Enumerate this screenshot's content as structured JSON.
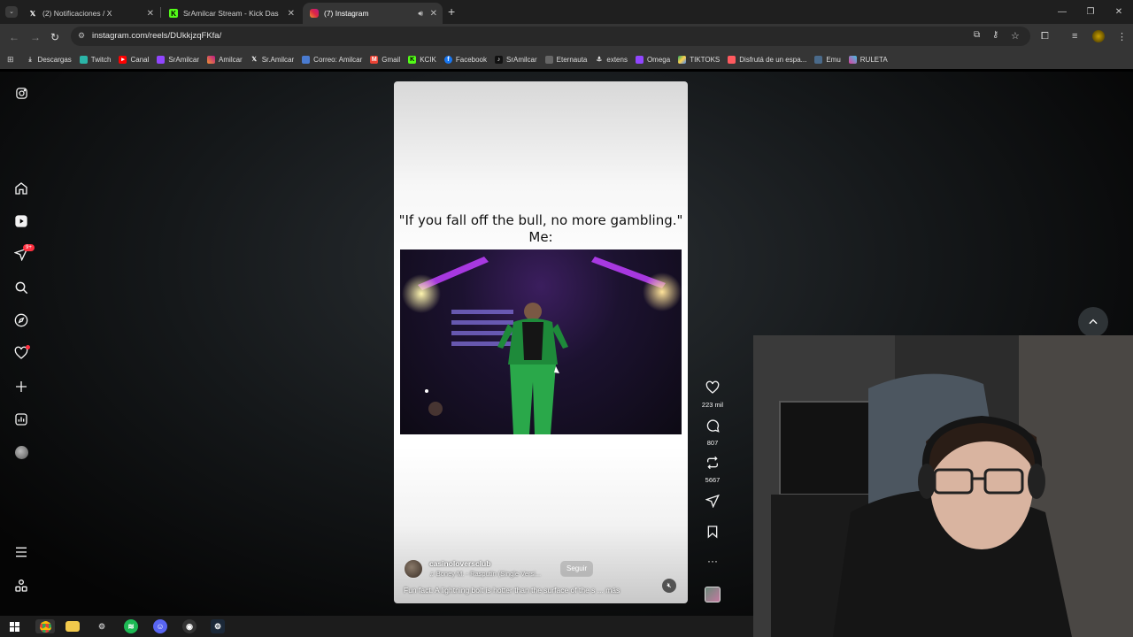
{
  "tabs": [
    {
      "label": "(2) Notificaciones / X",
      "icon": "x-logo-icon"
    },
    {
      "label": "SrAmilcar Stream - Kick Dashbo",
      "icon": "kick-logo-icon"
    },
    {
      "label": "(7) Instagram",
      "icon": "instagram-logo-icon"
    }
  ],
  "address": {
    "url": "instagram.com/reels/DUkkjzqFKfa/"
  },
  "bookmarks": [
    {
      "label": "Descargas",
      "icon": "download-icon",
      "color": "#3d3d3d"
    },
    {
      "label": "Twitch",
      "icon": "twitch-icon",
      "color": "#2bb5a8"
    },
    {
      "label": "Canal",
      "icon": "youtube-icon",
      "color": "#ff0000"
    },
    {
      "label": "SrAmilcar",
      "icon": "twitch-icon",
      "color": "#9146ff"
    },
    {
      "label": "Amilcar",
      "icon": "instagram-icon",
      "color": "#e1306c"
    },
    {
      "label": "Sr.Amilcar",
      "icon": "x-icon",
      "color": "#444"
    },
    {
      "label": "Correo: Amilcar",
      "icon": "mail-icon",
      "color": "#4a7bd0"
    },
    {
      "label": "Gmail",
      "icon": "gmail-icon",
      "color": "#ea4335"
    },
    {
      "label": "KCIK",
      "icon": "kick-icon",
      "color": "#53fc18"
    },
    {
      "label": "Facebook",
      "icon": "facebook-icon",
      "color": "#1877f2"
    },
    {
      "label": "SrAmilcar",
      "icon": "tiktok-icon",
      "color": "#111"
    },
    {
      "label": "Eternauta",
      "icon": "bookmark-icon",
      "color": "#666"
    },
    {
      "label": "extens",
      "icon": "anchor-icon",
      "color": "#555"
    },
    {
      "label": "Omega",
      "icon": "twitch-icon",
      "color": "#9146ff"
    },
    {
      "label": "TIKTOKS",
      "icon": "drive-icon",
      "color": "#1fa463"
    },
    {
      "label": "Disfrutá de un espa...",
      "icon": "airbnb-icon",
      "color": "#ff5a5f"
    },
    {
      "label": "Emu",
      "icon": "emu-icon",
      "color": "#4a6a8a"
    },
    {
      "label": "RULETA",
      "icon": "roulette-icon",
      "color": "#e040a0"
    }
  ],
  "nav": {
    "notifications_badge": "9+"
  },
  "reel": {
    "caption_line1": "\"If you fall off the bull, no more gambling.\"",
    "caption_line2": "Me:",
    "author": "casinoloversclub",
    "music": "Boney M. - Rasputin (Single Versi...",
    "follow_label": "Seguir",
    "description": "Fun fact: A lightning bolt is hotter than the surface of the s ... más",
    "likes": "223 mil",
    "comments": "807",
    "reposts": "5667"
  },
  "colors": {
    "background": "#000000",
    "accent": "#ff3040",
    "reel_bg": "#ffffff"
  }
}
